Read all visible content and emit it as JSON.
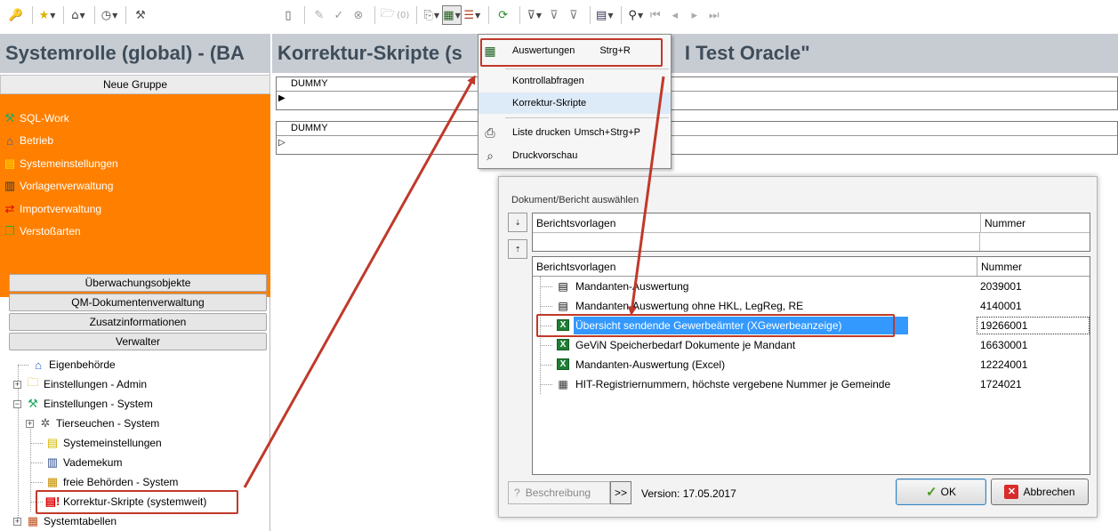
{
  "toolbar_left": {
    "buttons": [
      "user-key-icon",
      "star-icon",
      "home-icon",
      "clock-icon",
      "tools-icon"
    ]
  },
  "toolbar_right": {
    "buttons": [
      "new-doc-icon",
      "wand-icon",
      "check-icon",
      "cancel-icon",
      "folder-icon",
      "report-icon",
      "print-icon",
      "filter-icon",
      "grid-icon",
      "binoculars-icon",
      "first-icon",
      "prev-icon",
      "next-icon",
      "last-icon"
    ],
    "folder_count": "(0)"
  },
  "left_pane": {
    "title": "Systemrolle (global) - (BA",
    "group_header": "Neue Gruppe",
    "orange_items": [
      {
        "label": "SQL-Work",
        "icon": "tools-icon"
      },
      {
        "label": "Betrieb",
        "icon": "home-icon"
      },
      {
        "label": "Systemeinstellungen",
        "icon": "settings-page-icon"
      },
      {
        "label": "Vorlagenverwaltung",
        "icon": "template-icon"
      },
      {
        "label": "Importverwaltung",
        "icon": "import-icon"
      },
      {
        "label": "Verstoßarten",
        "icon": "folders-icon"
      }
    ],
    "nav_buttons": [
      "Überwachungsobjekte",
      "QM-Dokumentenverwaltung",
      "Zusatzinformationen",
      "Verwalter"
    ],
    "tree": [
      {
        "label": "Eigenbehörde",
        "icon": "home-icon",
        "expander": ""
      },
      {
        "label": "Einstellungen - Admin",
        "icon": "folder-icon",
        "expander": "+"
      },
      {
        "label": "Einstellungen - System",
        "icon": "tools-icon",
        "expander": "−"
      },
      {
        "label": "Tierseuchen - System",
        "icon": "virus-icon",
        "expander": "+"
      },
      {
        "label": "Systemeinstellungen",
        "icon": "settings-page-icon",
        "expander": ""
      },
      {
        "label": "Vademekum",
        "icon": "books-icon",
        "expander": ""
      },
      {
        "label": "freie Behörden - System",
        "icon": "building-icon",
        "expander": ""
      },
      {
        "label": "Korrektur-Skripte (systemweit)",
        "icon": "script-alert-icon",
        "expander": ""
      },
      {
        "label": "Systemtabellen",
        "icon": "table-icon",
        "expander": "+"
      }
    ]
  },
  "right_pane": {
    "title": "Korrektur-Skripte (s",
    "title_tail": "I Test Oracle\"",
    "grid1_header": "DUMMY",
    "grid2_header": "DUMMY"
  },
  "menu": {
    "items": [
      {
        "label": "Auswertungen",
        "shortcut": "Strg+R",
        "icon": "report-icon"
      },
      {
        "label": "Kontrollabfragen",
        "shortcut": "",
        "icon": ""
      },
      {
        "label": "Korrektur-Skripte",
        "shortcut": "",
        "icon": ""
      },
      {
        "label": "Liste drucken",
        "shortcut": "Umsch+Strg+P",
        "icon": "printer-icon"
      },
      {
        "label": "Druckvorschau",
        "shortcut": "",
        "icon": "preview-icon"
      }
    ]
  },
  "dialog": {
    "title": "Dokument/Bericht auswählen",
    "top_grid": {
      "col1": "Berichtsvorlagen",
      "col2": "Nummer"
    },
    "main_grid": {
      "col1": "Berichtsvorlagen",
      "col2": "Nummer",
      "rows": [
        {
          "name": "Mandanten-Auswertung",
          "number": "2039001",
          "icon": "word-doc-icon"
        },
        {
          "name": "Mandanten-Auswertung ohne HKL, LegReg, RE",
          "number": "4140001",
          "icon": "word-doc-icon"
        },
        {
          "name": "Übersicht sendende Gewerbeämter (XGewerbeanzeige)",
          "number": "19266001",
          "icon": "excel-icon"
        },
        {
          "name": "GeViN Speicherbedarf Dokumente je Mandant",
          "number": "16630001",
          "icon": "excel-icon"
        },
        {
          "name": "Mandanten-Auswertung (Excel)",
          "number": "12224001",
          "icon": "excel-icon"
        },
        {
          "name": "HIT-Registriernummern, höchste vergebene Nummer je Gemeinde",
          "number": "1724021",
          "icon": "table-icon"
        }
      ],
      "selected_index": 2
    },
    "description_label": "Beschreibung",
    "more_label": ">>",
    "version": "Version: 17.05.2017",
    "ok_label": "OK",
    "cancel_label": "Abbrechen"
  },
  "colors": {
    "accent_orange": "#ff8000",
    "title_bar": "#c7ccd3",
    "selection": "#3399ff",
    "annotation_red": "#c0392b"
  }
}
